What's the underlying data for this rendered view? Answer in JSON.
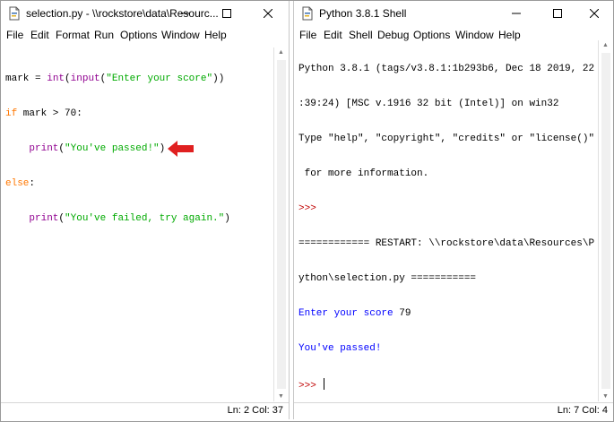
{
  "editor": {
    "title": "selection.py - \\\\rockstore\\data\\Resourc...",
    "menu": [
      "File",
      "Edit",
      "Format",
      "Run",
      "Options",
      "Window",
      "Help"
    ],
    "code": {
      "l1_var": "mark = ",
      "l1_int": "int",
      "l1_p1": "(",
      "l1_input": "input",
      "l1_p2": "(",
      "l1_str": "\"Enter your score\"",
      "l1_end": "))",
      "l2_kw": "if",
      "l2_rest": " mark > 70:",
      "l3_indent": "    ",
      "l3_print": "print",
      "l3_p": "(",
      "l3_str": "\"You've passed!\"",
      "l3_end": ")",
      "l4_kw": "else",
      "l4_end": ":",
      "l5_indent": "    ",
      "l5_print": "print",
      "l5_p": "(",
      "l5_str": "\"You've failed, try again.\"",
      "l5_end": ")"
    },
    "status": "Ln: 2   Col: 37"
  },
  "shell": {
    "title": "Python 3.8.1 Shell",
    "menu": [
      "File",
      "Edit",
      "Shell",
      "Debug",
      "Options",
      "Window",
      "Help"
    ],
    "lines": {
      "banner1": "Python 3.8.1 (tags/v3.8.1:1b293b6, Dec 18 2019, 22",
      "banner2": ":39:24) [MSC v.1916 32 bit (Intel)] on win32",
      "banner3": "Type \"help\", \"copyright\", \"credits\" or \"license()\"",
      "banner4": " for more information.",
      "prompt1": ">>>",
      "restart1": "============ RESTART: \\\\rockstore\\data\\Resources\\P",
      "restart2": "ython\\selection.py ===========",
      "input_prompt": "Enter your score ",
      "input_value": "79",
      "output": "You've passed!",
      "prompt2": ">>> "
    },
    "status": "Ln: 7   Col: 4"
  },
  "colors": {
    "keyword": "#ff7700",
    "builtin": "#900090",
    "string": "#00aa00",
    "output": "#0000ff",
    "prompt": "#c00000",
    "annotation_arrow": "#e02020"
  }
}
